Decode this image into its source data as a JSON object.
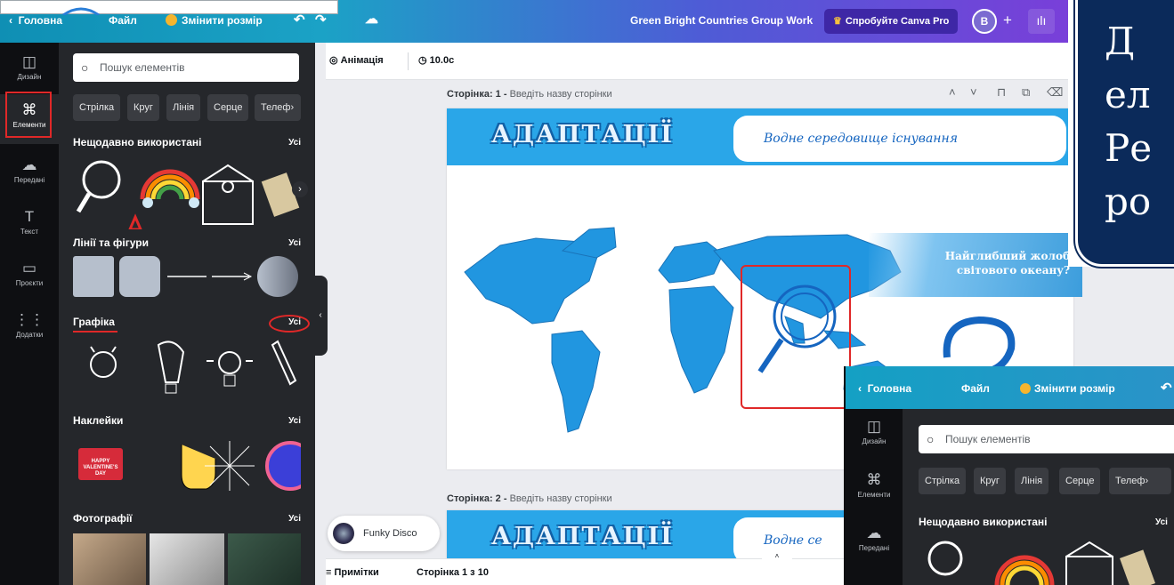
{
  "topbar": {
    "home": "Головна",
    "file": "Файл",
    "resize": "Змінити розмір",
    "project_title": "Green Bright Countries Group Work",
    "pro_button": "Спробуйте Canva Pro",
    "avatar": "B",
    "plus": "+",
    "chart_icon": "ılı"
  },
  "rail": [
    {
      "label": "Дизайн",
      "icon": "layout-icon",
      "glyph": "◫"
    },
    {
      "label": "Елементи",
      "icon": "elements-icon",
      "glyph": "⌘"
    },
    {
      "label": "Передані",
      "icon": "upload-icon",
      "glyph": "☁"
    },
    {
      "label": "Текст",
      "icon": "text-icon",
      "glyph": "T"
    },
    {
      "label": "Проєкти",
      "icon": "folder-icon",
      "glyph": "▭"
    },
    {
      "label": "Додатки",
      "icon": "apps-icon",
      "glyph": "⋮⋮"
    }
  ],
  "panel": {
    "search_placeholder": "Пошук елементів",
    "chips": [
      "Стрілка",
      "Круг",
      "Лінія",
      "Серце",
      "Телеф"
    ],
    "sections": [
      {
        "title": "Нещодавно використані",
        "all": "Усі"
      },
      {
        "title": "Лінії та фігури",
        "all": "Усі"
      },
      {
        "title": "Графіка",
        "all": "Усі"
      },
      {
        "title": "Наклейки",
        "all": "Усі"
      },
      {
        "title": "Фотографії",
        "all": "Усі"
      }
    ],
    "sticker_text": "HAPPY VALENTINE'S DAY"
  },
  "canvasbar": {
    "animation": "Анімація",
    "duration": "10.0с"
  },
  "pages": [
    {
      "label": "Сторінка: 1 -",
      "placeholder": "Введіть назву сторінки"
    },
    {
      "label": "Сторінка: 2 -",
      "placeholder": "Введіть назву сторінки"
    }
  ],
  "slide": {
    "title": "АДАПТАЦІЇ",
    "subtitle": "Водне середовище існування",
    "question_line1": "Найглибший жолоб",
    "question_line2": "світового океану?"
  },
  "page2": {
    "subtitle": "Водне се"
  },
  "music": {
    "track": "Funky Disco"
  },
  "status": {
    "notes": "Примітки",
    "page_count": "Сторінка 1 з 10"
  },
  "side_text": {
    "line1": "Д",
    "line2": "ел",
    "line3": "Ре",
    "line4": "ро"
  },
  "overlay": {
    "home": "Головна",
    "file": "Файл",
    "resize": "Змінити розмір",
    "search_placeholder": "Пошук елементів",
    "chips": [
      "Стрілка",
      "Круг",
      "Лінія",
      "Серце",
      "Телеф"
    ],
    "recent": "Нещодавно використані",
    "all": "Усі",
    "rail": [
      "Дизайн",
      "Елементи",
      "Передані"
    ]
  },
  "colors": {
    "accent_red": "#e02828",
    "banner_blue": "#2aa6e8",
    "map_blue": "#2196e0",
    "navy": "#0b2a5a"
  }
}
